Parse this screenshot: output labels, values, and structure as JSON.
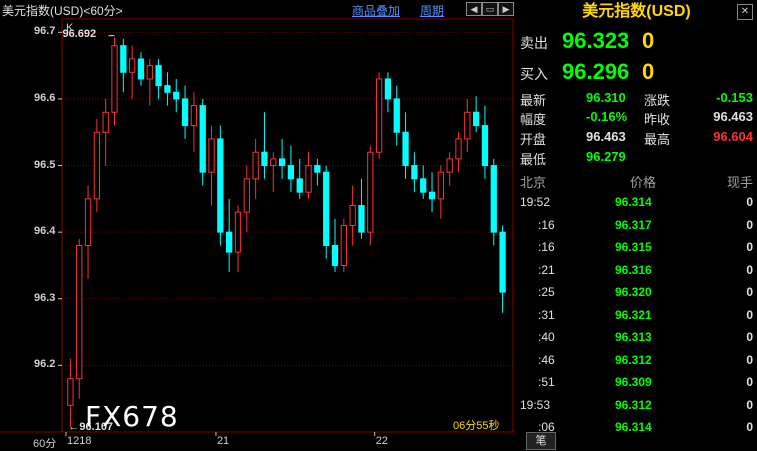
{
  "topbar": {
    "title": "美元指数(USD)<60分>",
    "btn_products": "商品叠加",
    "btn_period": "周期"
  },
  "chart_data": {
    "type": "candlestick",
    "interval": "60分",
    "ylim": [
      96.1,
      96.72
    ],
    "yticks": [
      "96.7",
      "96.6",
      "96.5",
      "96.4",
      "96.3",
      "96.2"
    ],
    "xticks": [
      {
        "label": "1218",
        "index": 0
      },
      {
        "label": "21",
        "index": 17
      },
      {
        "label": "22",
        "index": 35
      }
    ],
    "high_label": "96.692",
    "low_label": "96.107",
    "top_left_mark": "K",
    "timer": "06分55秒",
    "candles": [
      [
        96.14,
        96.21,
        96.107,
        96.18
      ],
      [
        96.18,
        96.39,
        96.15,
        96.38
      ],
      [
        96.38,
        96.47,
        96.33,
        96.45
      ],
      [
        96.45,
        96.57,
        96.43,
        96.55
      ],
      [
        96.55,
        96.6,
        96.5,
        96.58
      ],
      [
        96.58,
        96.692,
        96.56,
        96.68
      ],
      [
        96.68,
        96.69,
        96.61,
        96.64
      ],
      [
        96.64,
        96.68,
        96.6,
        96.66
      ],
      [
        96.66,
        96.67,
        96.62,
        96.63
      ],
      [
        96.63,
        96.66,
        96.59,
        96.65
      ],
      [
        96.65,
        96.66,
        96.6,
        96.62
      ],
      [
        96.62,
        96.64,
        96.59,
        96.61
      ],
      [
        96.61,
        96.63,
        96.58,
        96.6
      ],
      [
        96.6,
        96.62,
        96.54,
        96.56
      ],
      [
        96.56,
        96.61,
        96.52,
        96.59
      ],
      [
        96.59,
        96.6,
        96.47,
        96.49
      ],
      [
        96.49,
        96.56,
        96.44,
        96.54
      ],
      [
        96.54,
        96.56,
        96.38,
        96.4
      ],
      [
        96.4,
        96.45,
        96.34,
        96.37
      ],
      [
        96.37,
        96.44,
        96.34,
        96.43
      ],
      [
        96.43,
        96.5,
        96.4,
        96.48
      ],
      [
        96.48,
        96.54,
        96.45,
        96.52
      ],
      [
        96.52,
        96.58,
        96.48,
        96.5
      ],
      [
        96.5,
        96.52,
        96.46,
        96.51
      ],
      [
        96.51,
        96.54,
        96.48,
        96.5
      ],
      [
        96.5,
        96.53,
        96.46,
        96.48
      ],
      [
        96.48,
        96.51,
        96.45,
        96.46
      ],
      [
        96.46,
        96.52,
        96.45,
        96.5
      ],
      [
        96.5,
        96.51,
        96.47,
        96.49
      ],
      [
        96.49,
        96.5,
        96.36,
        96.38
      ],
      [
        96.38,
        96.42,
        96.34,
        96.35
      ],
      [
        96.35,
        96.42,
        96.34,
        96.41
      ],
      [
        96.41,
        96.47,
        96.38,
        96.44
      ],
      [
        96.44,
        96.48,
        96.39,
        96.4
      ],
      [
        96.4,
        96.53,
        96.38,
        96.52
      ],
      [
        96.52,
        96.64,
        96.51,
        96.63
      ],
      [
        96.63,
        96.64,
        96.58,
        96.6
      ],
      [
        96.6,
        96.62,
        96.53,
        96.55
      ],
      [
        96.55,
        96.58,
        96.48,
        96.5
      ],
      [
        96.5,
        96.52,
        96.46,
        96.48
      ],
      [
        96.48,
        96.5,
        96.45,
        96.46
      ],
      [
        96.46,
        96.49,
        96.43,
        96.45
      ],
      [
        96.45,
        96.5,
        96.42,
        96.49
      ],
      [
        96.49,
        96.52,
        96.47,
        96.51
      ],
      [
        96.51,
        96.55,
        96.49,
        96.54
      ],
      [
        96.54,
        96.6,
        96.52,
        96.58
      ],
      [
        96.58,
        96.604,
        96.55,
        96.56
      ],
      [
        96.56,
        96.59,
        96.48,
        96.5
      ],
      [
        96.5,
        96.51,
        96.38,
        96.4
      ],
      [
        96.4,
        96.41,
        96.279,
        96.31
      ]
    ]
  },
  "side": {
    "title": "美元指数(USD)",
    "sell_label": "卖出",
    "sell_price": "96.323",
    "sell_vol": "0",
    "buy_label": "买入",
    "buy_price": "96.296",
    "buy_vol": "0",
    "stats": {
      "latest_label": "最新",
      "latest": "96.310",
      "change_label": "涨跌",
      "change": "-0.153",
      "range_label": "幅度",
      "range": "-0.16%",
      "prev_label": "昨收",
      "prev": "96.463",
      "open_label": "开盘",
      "open": "96.463",
      "high_label": "最高",
      "high": "96.604",
      "low_label": "最低",
      "low": "96.279"
    },
    "tick_headers": [
      "北京",
      "价格",
      "现手"
    ],
    "ticks": [
      {
        "time": "19:52",
        "price": "96.314",
        "vol": "0",
        "full": true
      },
      {
        "time": ":16",
        "price": "96.317",
        "vol": "0",
        "full": false
      },
      {
        "time": ":16",
        "price": "96.315",
        "vol": "0",
        "full": false
      },
      {
        "time": ":21",
        "price": "96.316",
        "vol": "0",
        "full": false
      },
      {
        "time": ":25",
        "price": "96.320",
        "vol": "0",
        "full": false
      },
      {
        "time": ":31",
        "price": "96.321",
        "vol": "0",
        "full": false
      },
      {
        "time": ":40",
        "price": "96.313",
        "vol": "0",
        "full": false
      },
      {
        "time": ":46",
        "price": "96.312",
        "vol": "0",
        "full": false
      },
      {
        "time": ":51",
        "price": "96.309",
        "vol": "0",
        "full": false
      },
      {
        "time": "19:53",
        "price": "96.312",
        "vol": "0",
        "full": true
      },
      {
        "time": ":06",
        "price": "96.314",
        "vol": "0",
        "full": false
      }
    ],
    "tab_label": "笔"
  },
  "watermark": "FX678",
  "colors": {
    "up": "#ff3030",
    "down": "#00ffff",
    "grid": "#8b0000"
  }
}
